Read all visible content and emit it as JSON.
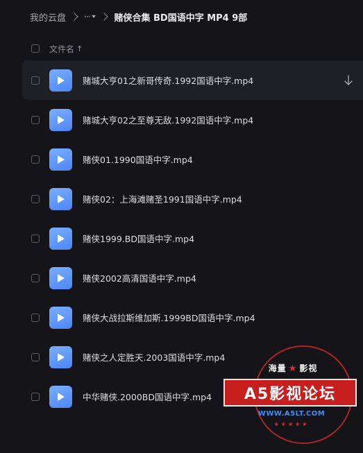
{
  "breadcrumb": {
    "root": "我的云盘",
    "more": "···",
    "current": "赌侠合集 BD国语中字 MP4 9部"
  },
  "list_header": {
    "column_name": "文件名",
    "sort_indicator": "↑"
  },
  "files": [
    {
      "name": "赌城大亨01之新哥传奇.1992国语中字.mp4"
    },
    {
      "name": "赌城大亨02之至尊无敌.1992国语中字.mp4"
    },
    {
      "name": "赌侠01.1990国语中字.mp4"
    },
    {
      "name": "赌侠02：上海滩赌圣1991国语中字.mp4"
    },
    {
      "name": "赌侠1999.BD国语中字.mp4"
    },
    {
      "name": "赌侠2002高清国语中字.mp4"
    },
    {
      "name": "赌侠大战拉斯维加斯.1999BD国语中字.mp4"
    },
    {
      "name": "赌侠之人定胜天.2003国语中字.mp4"
    },
    {
      "name": "中华赌侠.2000BD国语中字.mp4"
    }
  ],
  "icons": {
    "file": "video-play-icon",
    "download": "download-arrow-icon",
    "separator": "chevron-right-icon"
  },
  "colors": {
    "background": "#151519",
    "file_icon_accent": "#5b93fa",
    "watermark_red": "#c71e1e",
    "watermark_url_blue": "#3f8dff"
  },
  "watermark": {
    "top_left": "海量",
    "top_right": "影视",
    "title": "A5影视论坛",
    "url": "WWW.A5LT.COM",
    "star": "★",
    "bottom_stars": "★★★★★"
  }
}
